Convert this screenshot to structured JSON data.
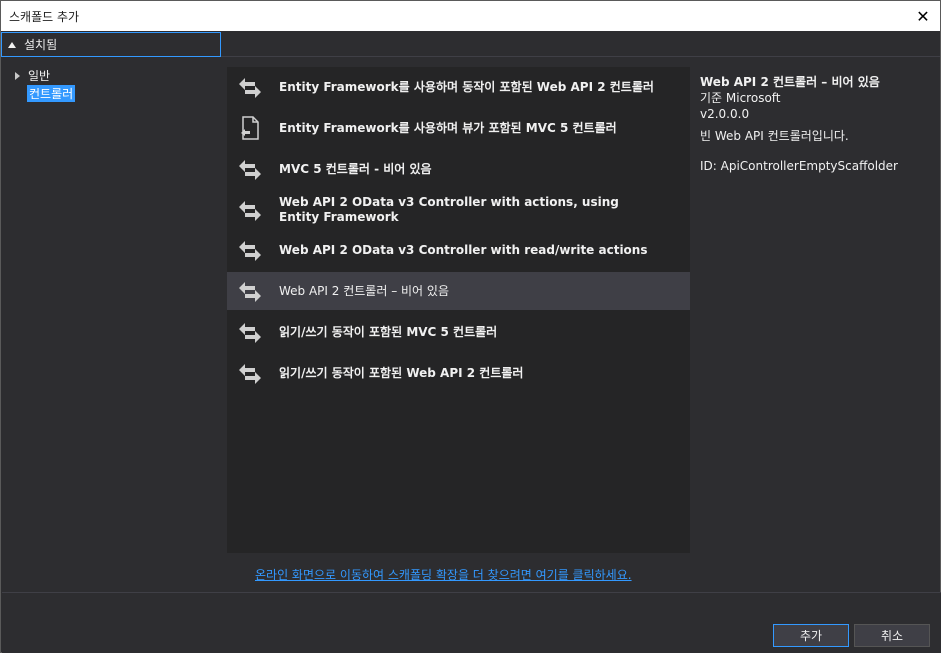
{
  "window": {
    "title": "스캐폴드 추가",
    "close_glyph": "✕"
  },
  "section_header": {
    "label": "설치됨"
  },
  "tree": {
    "general": "일반",
    "controller": "컨트롤러"
  },
  "items": [
    {
      "label": "Entity Framework를 사용하며 동작이 포함된 Web API 2 컨트롤러",
      "icon": "controller-icon"
    },
    {
      "label": "Entity Framework를 사용하며 뷰가 포함된 MVC 5 컨트롤러",
      "icon": "view-file-icon"
    },
    {
      "label": "MVC 5 컨트롤러 - 비어 있음",
      "icon": "controller-icon"
    },
    {
      "label": "Web API 2 OData v3 Controller with actions, using Entity Framework",
      "icon": "controller-icon"
    },
    {
      "label": "Web API 2 OData v3 Controller with read/write actions",
      "icon": "controller-icon"
    },
    {
      "label": "Web API 2 컨트롤러 – 비어 있음",
      "icon": "controller-icon",
      "selected": true
    },
    {
      "label": "읽기/쓰기 동작이 포함된 MVC 5 컨트롤러",
      "icon": "controller-icon"
    },
    {
      "label": "읽기/쓰기 동작이 포함된 Web API 2 컨트롤러",
      "icon": "controller-icon"
    }
  ],
  "details": {
    "title": "Web API 2 컨트롤러 – 비어 있음",
    "author": "기준 Microsoft",
    "version": "v2.0.0.0",
    "description": "빈 Web API 컨트롤러입니다.",
    "id": "ID: ApiControllerEmptyScaffolder"
  },
  "online_link": "온라인 화면으로 이동하여 스캐폴딩 확장을 더 찾으려면 여기를 클릭하세요.",
  "buttons": {
    "add": "추가",
    "cancel": "취소"
  },
  "colors": {
    "accent": "#3399ff",
    "background": "#2d2d30",
    "list_bg": "#252526",
    "selected": "#3f3f46"
  }
}
